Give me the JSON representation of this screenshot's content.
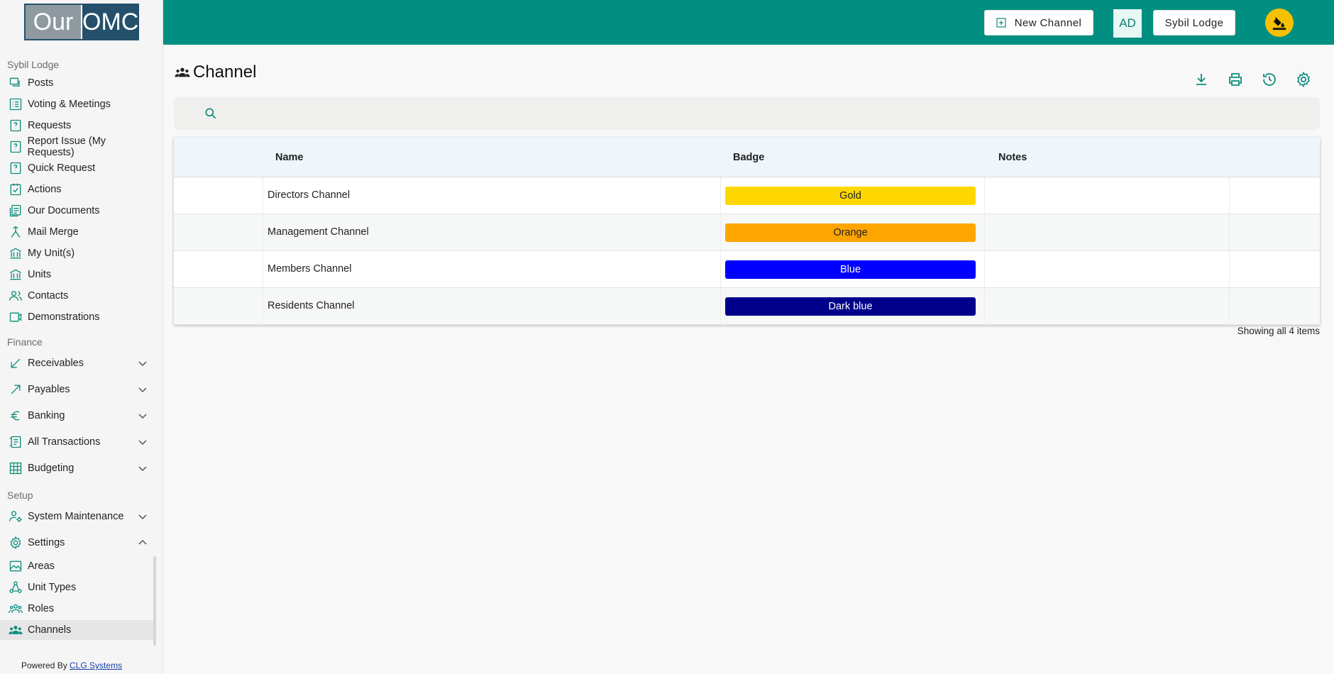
{
  "brand": {
    "logo_left": "Our",
    "logo_right": "OMC"
  },
  "sidebar": {
    "section_main": "Sybil Lodge",
    "main_items": [
      {
        "label": "Posts",
        "icon": "posts-icon"
      },
      {
        "label": "Voting & Meetings",
        "icon": "voting-icon"
      },
      {
        "label": "Requests",
        "icon": "requests-icon"
      },
      {
        "label": "Report Issue (My Requests)",
        "icon": "report-issue-icon"
      },
      {
        "label": "Quick Request",
        "icon": "quick-request-icon"
      },
      {
        "label": "Actions",
        "icon": "actions-icon"
      },
      {
        "label": "Our Documents",
        "icon": "documents-icon"
      },
      {
        "label": "Mail Merge",
        "icon": "mail-merge-icon"
      },
      {
        "label": "My Unit(s)",
        "icon": "my-units-icon"
      },
      {
        "label": "Units",
        "icon": "units-icon"
      },
      {
        "label": "Contacts",
        "icon": "contacts-icon"
      },
      {
        "label": "Demonstrations",
        "icon": "video-icon"
      }
    ],
    "section_finance": "Finance",
    "finance_items": [
      {
        "label": "Receivables",
        "icon": "receivables-icon"
      },
      {
        "label": "Payables",
        "icon": "payables-icon"
      },
      {
        "label": "Banking",
        "icon": "euro-icon"
      },
      {
        "label": "All Transactions",
        "icon": "transactions-icon"
      },
      {
        "label": "Budgeting",
        "icon": "budgeting-icon"
      }
    ],
    "section_setup": "Setup",
    "setup_items": [
      {
        "label": "System Maintenance",
        "icon": "system-maintenance-icon"
      },
      {
        "label": "Settings",
        "icon": "settings-icon"
      }
    ],
    "settings_children": [
      {
        "label": "Areas",
        "icon": "areas-icon"
      },
      {
        "label": "Unit Types",
        "icon": "unit-types-icon"
      },
      {
        "label": "Roles",
        "icon": "roles-icon"
      },
      {
        "label": "Channels",
        "icon": "channels-icon",
        "active": true
      }
    ],
    "powered_by": "Powered By",
    "powered_link": "CLG Systems"
  },
  "topbar": {
    "new_button": "New Channel",
    "initials": "AD",
    "user_button": "Sybil Lodge",
    "accent": "#008f80"
  },
  "page": {
    "title": "Channel",
    "search_placeholder": "",
    "toolbar_icons": [
      "download-icon",
      "print-icon",
      "history-icon",
      "settings-icon"
    ]
  },
  "grid": {
    "columns": [
      "Name",
      "Badge",
      "Notes"
    ],
    "rows": [
      {
        "name": "Directors Channel",
        "badge": "Gold",
        "badge_bg": "#ffd700",
        "badge_fg": "#222222",
        "notes": ""
      },
      {
        "name": "Management Channel",
        "badge": "Orange",
        "badge_bg": "#ffa500",
        "badge_fg": "#222222",
        "notes": ""
      },
      {
        "name": "Members Channel",
        "badge": "Blue",
        "badge_bg": "#0000ff",
        "badge_fg": "#ffffff",
        "notes": ""
      },
      {
        "name": "Residents Channel",
        "badge": "Dark blue",
        "badge_bg": "#00008b",
        "badge_fg": "#ffffff",
        "notes": ""
      }
    ],
    "footer": "Showing all 4 items"
  }
}
